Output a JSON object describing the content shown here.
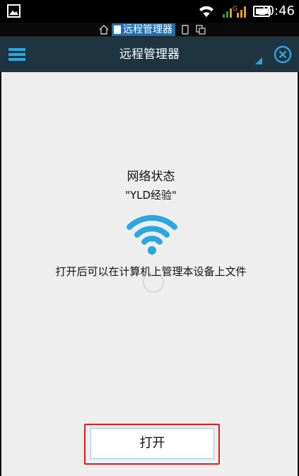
{
  "status_bar": {
    "time": "20:46",
    "icons": [
      "gallery-icon",
      "wifi-icon",
      "signal-icon",
      "battery-icon"
    ]
  },
  "taskbar": {
    "active_app": "远程管理器",
    "icons": [
      "home-icon",
      "phone-icon",
      "copy-icon"
    ]
  },
  "app_bar": {
    "title": "远程管理器",
    "icons": [
      "menu-icon",
      "dropdown-indicator-icon",
      "close-circle-icon"
    ]
  },
  "main": {
    "status_heading": "网络状态",
    "network_name": "\"YLD经验\"",
    "description": "打开后可以在计算机上管理本设备上文件",
    "open_button_label": "打开"
  },
  "colors": {
    "app_bar_bg": "#1f3441",
    "accent_blue": "#2aa7e0",
    "content_bg": "#eeeeee",
    "highlight_red": "#e01a1a"
  }
}
